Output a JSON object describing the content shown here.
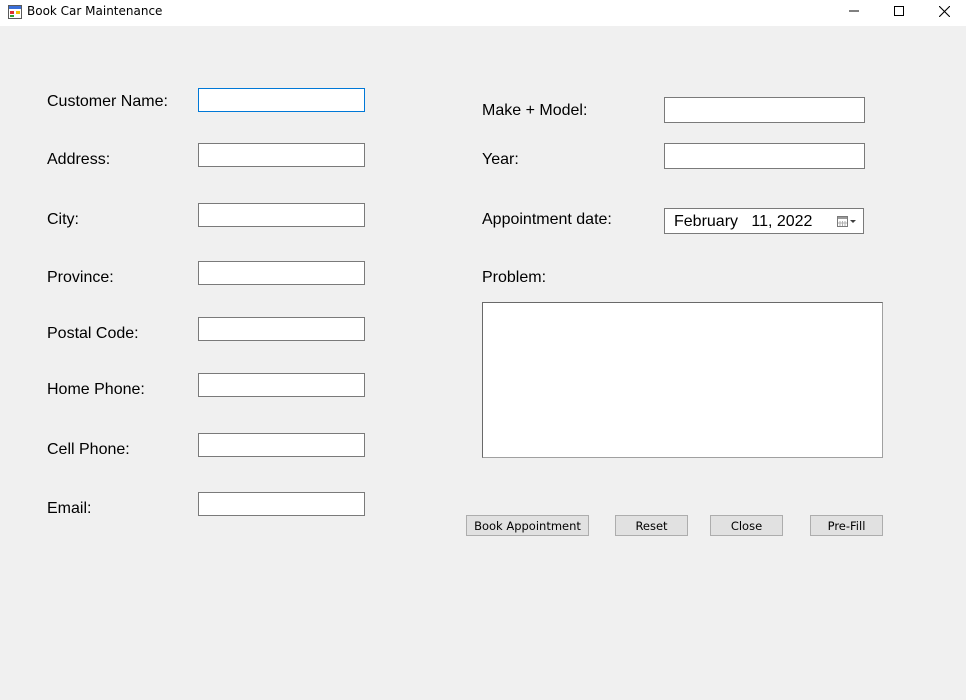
{
  "window": {
    "title": "Book Car Maintenance"
  },
  "labels": {
    "customer_name": "Customer Name:",
    "address": "Address:",
    "city": "City:",
    "province": "Province:",
    "postal_code": "Postal Code:",
    "home_phone": "Home Phone:",
    "cell_phone": "Cell Phone:",
    "email": "Email:",
    "make_model": "Make + Model:",
    "year": "Year:",
    "appointment_date": "Appointment date:",
    "problem": "Problem:"
  },
  "fields": {
    "customer_name": "",
    "address": "",
    "city": "",
    "province": "",
    "postal_code": "",
    "home_phone": "",
    "cell_phone": "",
    "email": "",
    "make_model": "",
    "year": "",
    "problem": ""
  },
  "appointment_date": "February   11, 2022",
  "buttons": {
    "book": "Book Appointment",
    "reset": "Reset",
    "close": "Close",
    "prefill": "Pre-Fill"
  },
  "icons": {
    "app": "app-form-icon",
    "minimize": "minimize-icon",
    "maximize": "maximize-icon",
    "close": "close-icon",
    "calendar": "calendar-dropdown-icon"
  },
  "colors": {
    "focus_border": "#0078d7",
    "window_bg": "#f0f0f0"
  }
}
